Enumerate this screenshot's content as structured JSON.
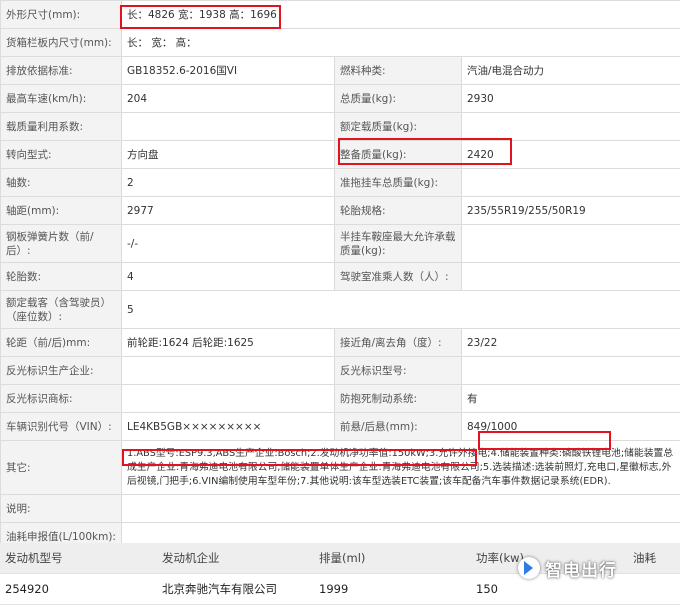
{
  "spec_rows": [
    {
      "l1": "外形尺寸(mm):",
      "v1": "长：4826 宽：1938 高：1696"
    },
    {
      "l1": "货箱栏板内尺寸(mm):",
      "v1": "长：  宽：  高："
    },
    {
      "l1": "排放依据标准:",
      "v1": "GB18352.6-2016国VI",
      "l2": "燃料种类:",
      "v2": "汽油/电混合动力"
    },
    {
      "l1": "最高车速(km/h):",
      "v1": "204",
      "l2": "总质量(kg):",
      "v2": "2930"
    },
    {
      "l1": "载质量利用系数:",
      "v1": "",
      "l2": "额定载质量(kg):",
      "v2": ""
    },
    {
      "l1": "转向型式:",
      "v1": "方向盘",
      "l2": "整备质量(kg):",
      "v2": "2420"
    },
    {
      "l1": "轴数:",
      "v1": "2",
      "l2": "准拖挂车总质量(kg):",
      "v2": ""
    },
    {
      "l1": "轴距(mm):",
      "v1": "2977",
      "l2": "轮胎规格:",
      "v2": "235/55R19/255/50R19"
    },
    {
      "l1": "钢板弹簧片数（前/后）:",
      "v1": "-/-",
      "l2": "半挂车鞍座最大允许承载质量(kg):",
      "v2": ""
    },
    {
      "l1": "轮胎数:",
      "v1": "4",
      "l2": "驾驶室准乘人数（人）:",
      "v2": ""
    },
    {
      "l1": "额定载客（含驾驶员）（座位数）:",
      "v1": "5"
    },
    {
      "l1": "轮距（前/后)mm:",
      "v1": "前轮距:1624 后轮距:1625",
      "l2": "接近角/离去角（度）:",
      "v2": "23/22"
    },
    {
      "l1": "反光标识生产企业:",
      "v1": "",
      "l2": "反光标识型号:",
      "v2": ""
    },
    {
      "l1": "反光标识商标:",
      "v1": "",
      "l2": "防抱死制动系统:",
      "v2": "有"
    },
    {
      "l1": "车辆识别代号（VIN）:",
      "v1": "LE4KB5GB×××××××××",
      "l2": "前悬/后悬(mm):",
      "v2": "849/1000"
    },
    {
      "l1": "其它:",
      "v1": "1.ABS型号:ESP9.3,ABS生产企业:Bosch;2.发动机净功率值:150kW;3.允许外接电;4.储能装置种类:磷酸铁锂电池;储能装置总成生产企业:青海弗迪电池有限公司,储能装置单体生产企业:青海弗迪电池有限公司;5.选装描述:选装前照灯,充电口,星徽标志,外后视镜,门把手;6.VIN编制使用车型年份;7.其他说明:该车型选装ETC装置;该车配备汽车事件数据记录系统(EDR)."
    },
    {
      "l1": "说明:",
      "v1": ""
    },
    {
      "l1": "油耗申报值(L/100km):",
      "v1": ""
    }
  ],
  "engine_table": {
    "headers": [
      "发动机型号",
      "发动机企业",
      "排量(ml)",
      "功率(kw)",
      "油耗"
    ],
    "row": [
      "254920",
      "北京奔驰汽车有限公司",
      "1999",
      "150",
      ""
    ]
  },
  "watermark": "智电出行",
  "highlight_color": "#e0141e"
}
